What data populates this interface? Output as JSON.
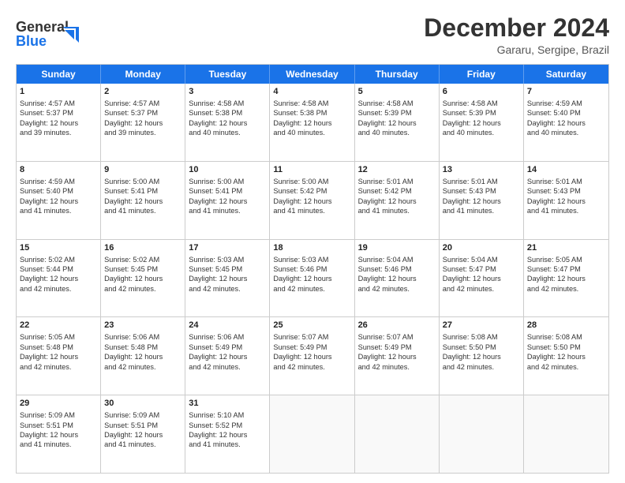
{
  "logo": {
    "line1": "General",
    "line2": "Blue"
  },
  "title": "December 2024",
  "subtitle": "Gararu, Sergipe, Brazil",
  "days_of_week": [
    "Sunday",
    "Monday",
    "Tuesday",
    "Wednesday",
    "Thursday",
    "Friday",
    "Saturday"
  ],
  "weeks": [
    [
      {
        "day": "1",
        "lines": [
          "Sunrise: 4:57 AM",
          "Sunset: 5:37 PM",
          "Daylight: 12 hours",
          "and 39 minutes."
        ]
      },
      {
        "day": "2",
        "lines": [
          "Sunrise: 4:57 AM",
          "Sunset: 5:37 PM",
          "Daylight: 12 hours",
          "and 39 minutes."
        ]
      },
      {
        "day": "3",
        "lines": [
          "Sunrise: 4:58 AM",
          "Sunset: 5:38 PM",
          "Daylight: 12 hours",
          "and 40 minutes."
        ]
      },
      {
        "day": "4",
        "lines": [
          "Sunrise: 4:58 AM",
          "Sunset: 5:38 PM",
          "Daylight: 12 hours",
          "and 40 minutes."
        ]
      },
      {
        "day": "5",
        "lines": [
          "Sunrise: 4:58 AM",
          "Sunset: 5:39 PM",
          "Daylight: 12 hours",
          "and 40 minutes."
        ]
      },
      {
        "day": "6",
        "lines": [
          "Sunrise: 4:58 AM",
          "Sunset: 5:39 PM",
          "Daylight: 12 hours",
          "and 40 minutes."
        ]
      },
      {
        "day": "7",
        "lines": [
          "Sunrise: 4:59 AM",
          "Sunset: 5:40 PM",
          "Daylight: 12 hours",
          "and 40 minutes."
        ]
      }
    ],
    [
      {
        "day": "8",
        "lines": [
          "Sunrise: 4:59 AM",
          "Sunset: 5:40 PM",
          "Daylight: 12 hours",
          "and 41 minutes."
        ]
      },
      {
        "day": "9",
        "lines": [
          "Sunrise: 5:00 AM",
          "Sunset: 5:41 PM",
          "Daylight: 12 hours",
          "and 41 minutes."
        ]
      },
      {
        "day": "10",
        "lines": [
          "Sunrise: 5:00 AM",
          "Sunset: 5:41 PM",
          "Daylight: 12 hours",
          "and 41 minutes."
        ]
      },
      {
        "day": "11",
        "lines": [
          "Sunrise: 5:00 AM",
          "Sunset: 5:42 PM",
          "Daylight: 12 hours",
          "and 41 minutes."
        ]
      },
      {
        "day": "12",
        "lines": [
          "Sunrise: 5:01 AM",
          "Sunset: 5:42 PM",
          "Daylight: 12 hours",
          "and 41 minutes."
        ]
      },
      {
        "day": "13",
        "lines": [
          "Sunrise: 5:01 AM",
          "Sunset: 5:43 PM",
          "Daylight: 12 hours",
          "and 41 minutes."
        ]
      },
      {
        "day": "14",
        "lines": [
          "Sunrise: 5:01 AM",
          "Sunset: 5:43 PM",
          "Daylight: 12 hours",
          "and 41 minutes."
        ]
      }
    ],
    [
      {
        "day": "15",
        "lines": [
          "Sunrise: 5:02 AM",
          "Sunset: 5:44 PM",
          "Daylight: 12 hours",
          "and 42 minutes."
        ]
      },
      {
        "day": "16",
        "lines": [
          "Sunrise: 5:02 AM",
          "Sunset: 5:45 PM",
          "Daylight: 12 hours",
          "and 42 minutes."
        ]
      },
      {
        "day": "17",
        "lines": [
          "Sunrise: 5:03 AM",
          "Sunset: 5:45 PM",
          "Daylight: 12 hours",
          "and 42 minutes."
        ]
      },
      {
        "day": "18",
        "lines": [
          "Sunrise: 5:03 AM",
          "Sunset: 5:46 PM",
          "Daylight: 12 hours",
          "and 42 minutes."
        ]
      },
      {
        "day": "19",
        "lines": [
          "Sunrise: 5:04 AM",
          "Sunset: 5:46 PM",
          "Daylight: 12 hours",
          "and 42 minutes."
        ]
      },
      {
        "day": "20",
        "lines": [
          "Sunrise: 5:04 AM",
          "Sunset: 5:47 PM",
          "Daylight: 12 hours",
          "and 42 minutes."
        ]
      },
      {
        "day": "21",
        "lines": [
          "Sunrise: 5:05 AM",
          "Sunset: 5:47 PM",
          "Daylight: 12 hours",
          "and 42 minutes."
        ]
      }
    ],
    [
      {
        "day": "22",
        "lines": [
          "Sunrise: 5:05 AM",
          "Sunset: 5:48 PM",
          "Daylight: 12 hours",
          "and 42 minutes."
        ]
      },
      {
        "day": "23",
        "lines": [
          "Sunrise: 5:06 AM",
          "Sunset: 5:48 PM",
          "Daylight: 12 hours",
          "and 42 minutes."
        ]
      },
      {
        "day": "24",
        "lines": [
          "Sunrise: 5:06 AM",
          "Sunset: 5:49 PM",
          "Daylight: 12 hours",
          "and 42 minutes."
        ]
      },
      {
        "day": "25",
        "lines": [
          "Sunrise: 5:07 AM",
          "Sunset: 5:49 PM",
          "Daylight: 12 hours",
          "and 42 minutes."
        ]
      },
      {
        "day": "26",
        "lines": [
          "Sunrise: 5:07 AM",
          "Sunset: 5:49 PM",
          "Daylight: 12 hours",
          "and 42 minutes."
        ]
      },
      {
        "day": "27",
        "lines": [
          "Sunrise: 5:08 AM",
          "Sunset: 5:50 PM",
          "Daylight: 12 hours",
          "and 42 minutes."
        ]
      },
      {
        "day": "28",
        "lines": [
          "Sunrise: 5:08 AM",
          "Sunset: 5:50 PM",
          "Daylight: 12 hours",
          "and 42 minutes."
        ]
      }
    ],
    [
      {
        "day": "29",
        "lines": [
          "Sunrise: 5:09 AM",
          "Sunset: 5:51 PM",
          "Daylight: 12 hours",
          "and 41 minutes."
        ]
      },
      {
        "day": "30",
        "lines": [
          "Sunrise: 5:09 AM",
          "Sunset: 5:51 PM",
          "Daylight: 12 hours",
          "and 41 minutes."
        ]
      },
      {
        "day": "31",
        "lines": [
          "Sunrise: 5:10 AM",
          "Sunset: 5:52 PM",
          "Daylight: 12 hours",
          "and 41 minutes."
        ]
      },
      {
        "day": "",
        "lines": []
      },
      {
        "day": "",
        "lines": []
      },
      {
        "day": "",
        "lines": []
      },
      {
        "day": "",
        "lines": []
      }
    ]
  ]
}
